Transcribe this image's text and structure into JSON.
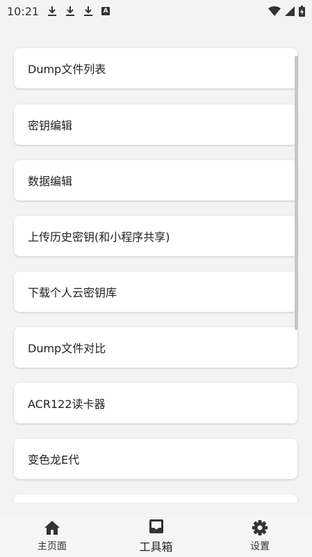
{
  "status": {
    "time": "10:21",
    "notification_icons": [
      "download-icon",
      "download-icon",
      "download-icon",
      "a-badge-icon"
    ],
    "notification_badge": "A",
    "right_icons": [
      "wifi-icon",
      "signal-icon",
      "battery-icon"
    ]
  },
  "menu": {
    "items": [
      {
        "label": "Dump文件列表"
      },
      {
        "label": "密钥编辑"
      },
      {
        "label": "数据编辑"
      },
      {
        "label": "上传历史密钥(和小程序共享)"
      },
      {
        "label": "下载个人云密钥库"
      },
      {
        "label": "Dump文件对比"
      },
      {
        "label": "ACR122读卡器"
      },
      {
        "label": "变色龙E代"
      }
    ]
  },
  "nav": {
    "home_label": "主页面",
    "toolbox_label": "工具箱",
    "settings_label": "设置",
    "active": "toolbox"
  }
}
